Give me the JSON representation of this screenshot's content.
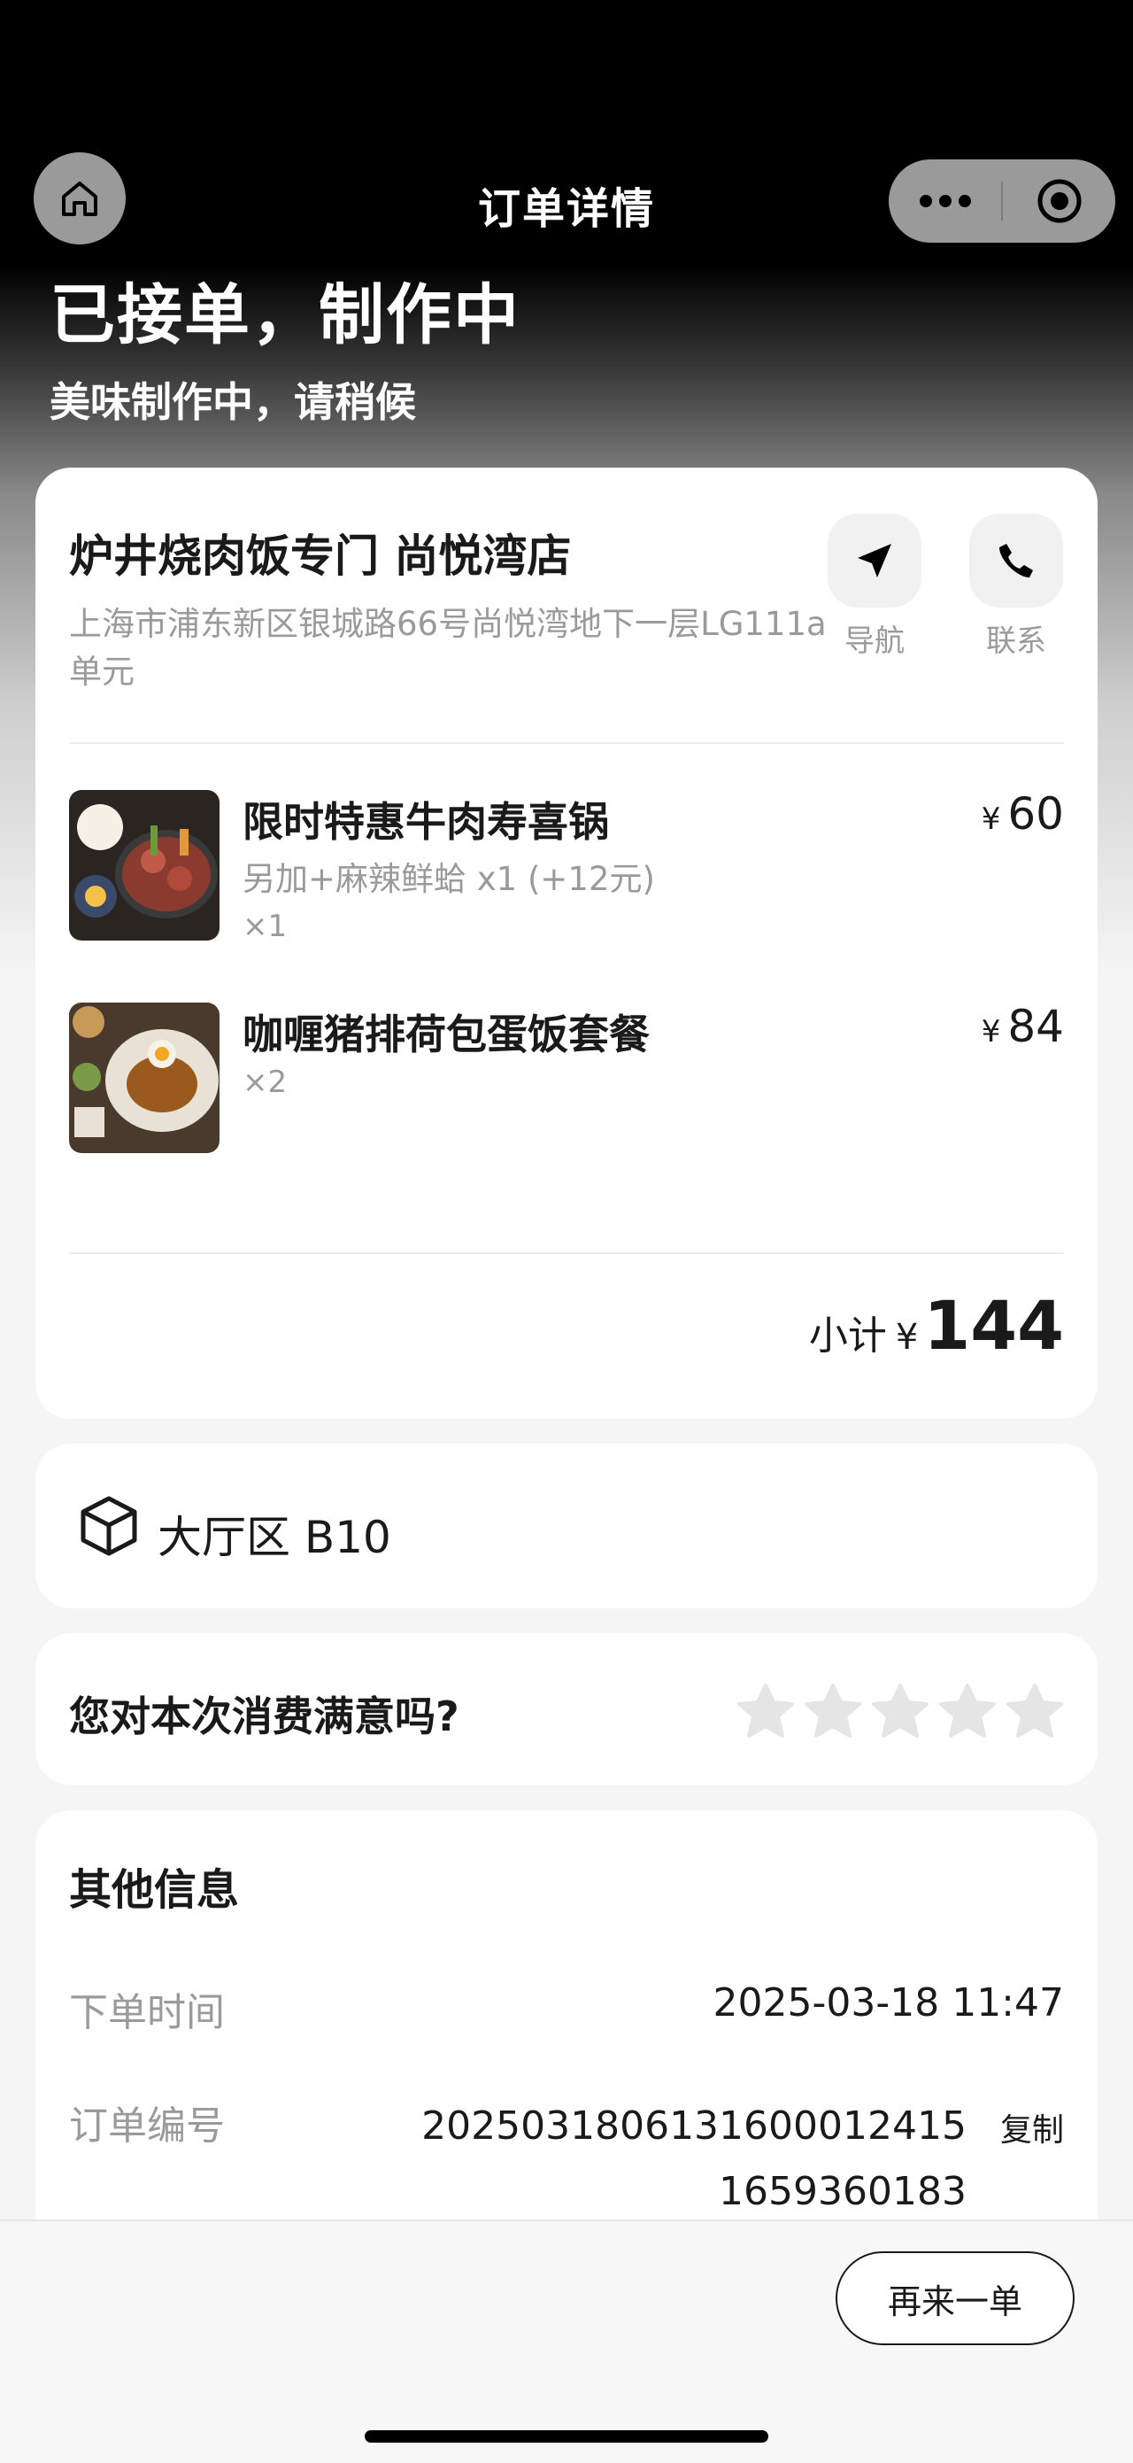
{
  "header": {
    "title": "订单详情"
  },
  "status": {
    "title": "已接单，制作中",
    "subtitle": "美味制作中，请稍候"
  },
  "shop": {
    "name": "炉井烧肉饭专门 尚悦湾店",
    "address": "上海市浦东新区银城路66号尚悦湾地下一层LG111a单元",
    "actions": [
      {
        "label": "导航",
        "icon": "navigation-arrow-icon"
      },
      {
        "label": "联系",
        "icon": "phone-icon"
      }
    ]
  },
  "items": [
    {
      "name": "限时特惠牛肉寿喜锅",
      "spec": "另加+麻辣鲜蛤 x1 (+12元)",
      "qty": "×1",
      "currency": "¥",
      "price": "60",
      "image": "sukiyaki-photo"
    },
    {
      "name": "咖喱猪排荷包蛋饭套餐",
      "spec": "",
      "qty": "×2",
      "currency": "¥",
      "price": "84",
      "image": "curry-rice-photo"
    }
  ],
  "subtotal": {
    "label": "小计",
    "currency": "¥",
    "value": "144"
  },
  "table": {
    "icon": "box-icon",
    "label": "大厅区 B10"
  },
  "rating": {
    "question": "您对本次消费满意吗?",
    "stars": 5,
    "filled": 0
  },
  "other_info": {
    "title": "其他信息",
    "order_time_label": "下单时间",
    "order_time": "2025-03-18 11:47",
    "order_no_label": "订单编号",
    "order_no": "2025031806131600012415 1659360183",
    "copy_label": "复制"
  },
  "footer": {
    "reorder_label": "再来一单"
  },
  "colors": {
    "background": "#f5f5f5",
    "text": "#1a1a1a",
    "muted": "#9a9a9a",
    "star": "#e5e5e5"
  }
}
